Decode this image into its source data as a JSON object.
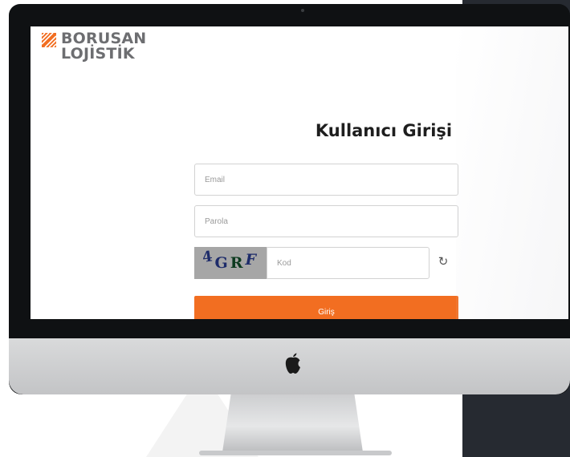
{
  "brand": {
    "line1": "BORUSAN",
    "line2": "LOJİSTİK",
    "color": "#f26e21",
    "text_color": "#6d6e71",
    "logo_icon": "borusan-stripes-logo"
  },
  "login": {
    "title": "Kullanıcı Girişi",
    "email_placeholder": "Email",
    "password_placeholder": "Parola",
    "captcha_chars": [
      "4",
      "G",
      "R",
      "F"
    ],
    "code_placeholder": "Kod",
    "refresh_icon": "refresh-icon",
    "submit_label": "Giriş",
    "accent_color": "#f26e21"
  },
  "device": {
    "logo_icon": "apple-logo-icon"
  }
}
